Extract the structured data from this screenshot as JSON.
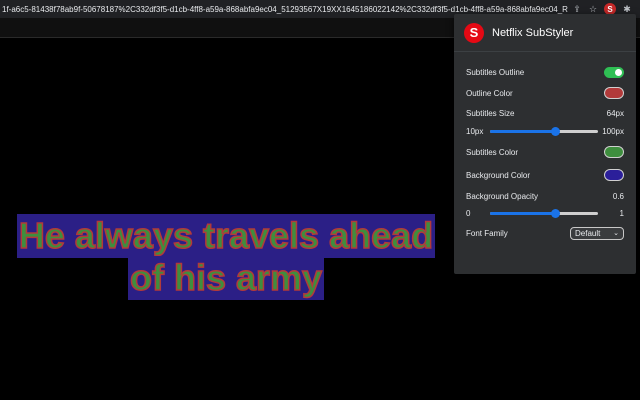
{
  "browser": {
    "url": "1f-a6c5-81438f78ab9f-50678187%2C332df3f5-d1cb-4ff8-a59a-868abfa9ec04_51293567X19XX1645186022142%2C332df3f5-d1cb-4ff8-a59a-868abfa9ec04_R...",
    "icons": [
      "share-icon",
      "star-icon",
      "extension-icon",
      "puzzle-icon"
    ],
    "extension_badge": "S"
  },
  "subtitles": {
    "lines": [
      "He always travels ahead",
      "of his army"
    ],
    "text_color": "#3e8e3e",
    "outline_color": "#b23a3a",
    "background_color": "#2b1f86"
  },
  "popup": {
    "logo_letter": "S",
    "title": "Netflix SubStyler",
    "outline": {
      "label": "Subtitles Outline",
      "enabled": true
    },
    "outline_color": {
      "label": "Outline Color",
      "color": "#b23a3a"
    },
    "size": {
      "label": "Subtitles Size",
      "value": "64px",
      "min": "10px",
      "max": "100px",
      "fraction": 0.6
    },
    "subtitles_color": {
      "label": "Subtitles Color",
      "color": "#3e8e3e"
    },
    "background_color": {
      "label": "Background Color",
      "color": "#2b1f9a"
    },
    "opacity": {
      "label": "Background Opacity",
      "value": "0.6",
      "min": "0",
      "max": "1",
      "fraction": 0.6
    },
    "font_family": {
      "label": "Font Family",
      "selected": "Default"
    }
  }
}
